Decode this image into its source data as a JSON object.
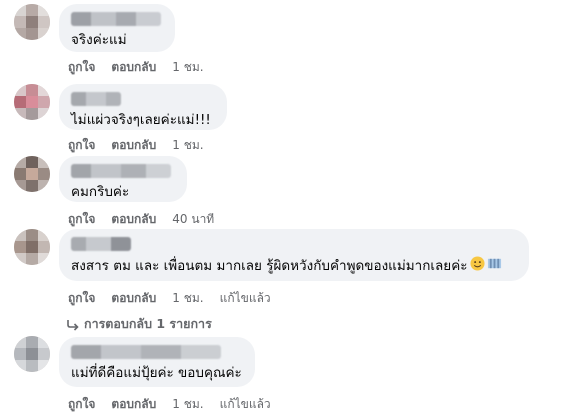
{
  "comments": [
    {
      "text": "จริงค่ะแม่",
      "actions": {
        "like": "ถูกใจ",
        "reply": "ตอบกลับ",
        "time": "1 ชม.",
        "edited": ""
      }
    },
    {
      "text": "ไม่แผ่วจริงๆเลยค่ะแม่!!!",
      "actions": {
        "like": "ถูกใจ",
        "reply": "ตอบกลับ",
        "time": "1 ชม.",
        "edited": ""
      }
    },
    {
      "text": "คมกริบค่ะ",
      "actions": {
        "like": "ถูกใจ",
        "reply": "ตอบกลับ",
        "time": "40 นาที",
        "edited": ""
      }
    },
    {
      "text": "สงสาร ตม และ เพื่อนตม มากเลย รู้ผิดหวังกับคำพูดของแม่มากเลยค่ะ",
      "actions": {
        "like": "ถูกใจ",
        "reply": "ตอบกลับ",
        "time": "1 ชม.",
        "edited": "แก้ไขแล้ว"
      },
      "replies_link": "การตอบกลับ 1 รายการ"
    },
    {
      "text": "แม่ที่ดีคือแม่ปุ้ยค่ะ ขอบคุณค่ะ",
      "actions": {
        "like": "ถูกใจ",
        "reply": "ตอบกลับ",
        "time": "1 ชม.",
        "edited": "แก้ไขแล้ว"
      }
    }
  ],
  "icons": {
    "reply_arrow": "reply-arrow-icon",
    "emoji_face": "smiling-face-emoji-icon",
    "emoji_flag": "flag-emoji-icon"
  }
}
